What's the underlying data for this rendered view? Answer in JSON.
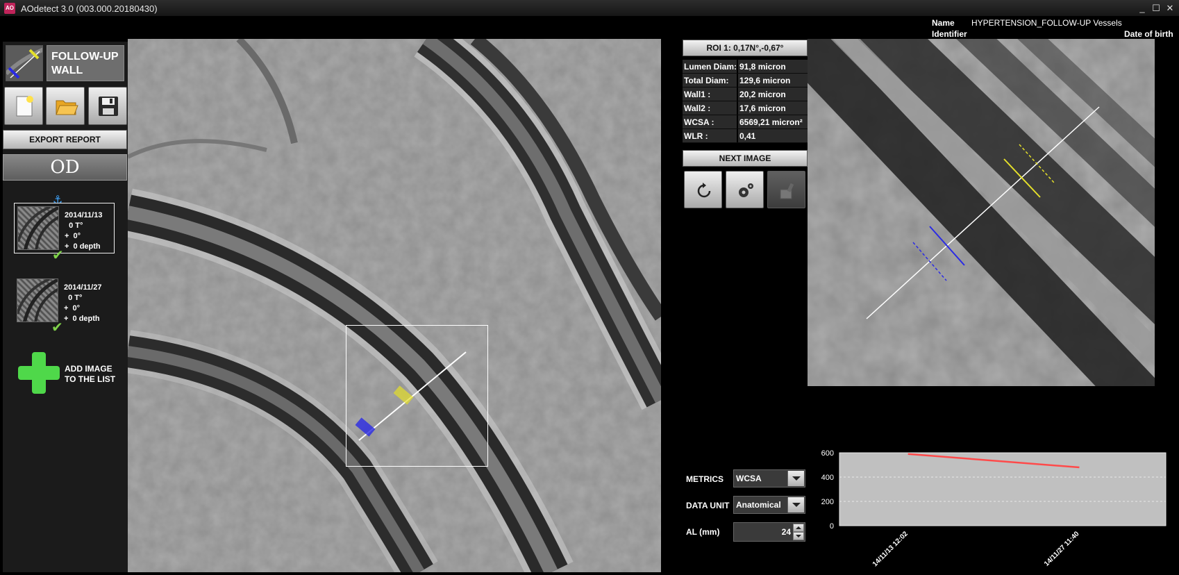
{
  "window": {
    "title": "AOdetect 3.0 (003.000.20180430)",
    "icon_text": "AO",
    "minimize": "_",
    "maximize": "☐",
    "close": "✕"
  },
  "patient": {
    "name_label": "Name",
    "name_value": "HYPERTENSION_FOLLOW-UP Vessels",
    "identifier_label": "Identifier",
    "dob_label": "Date of birth"
  },
  "left": {
    "mode_label_line1": "FOLLOW-UP",
    "mode_label_line2": "WALL",
    "export_label": "EXPORT REPORT",
    "eye_label": "OD",
    "images": [
      {
        "date": "2014/11/13",
        "t": "  0 T°",
        "d1": "+  0°",
        "d2": "+  0 depth",
        "selected": true
      },
      {
        "date": "2014/11/27",
        "t": "  0 T°",
        "d1": "+  0°",
        "d2": "+  0 depth",
        "selected": false
      }
    ],
    "add_label_line1": "ADD IMAGE",
    "add_label_line2": "TO THE LIST"
  },
  "roi": {
    "header": "ROI 1: 0,17N°,-0,67°",
    "metrics": [
      {
        "label": "Lumen Diam:",
        "value": "91,8  micron"
      },
      {
        "label": "Total Diam:",
        "value": "129,6  micron"
      },
      {
        "label": "Wall1 :",
        "value": "20,2  micron"
      },
      {
        "label": "Wall2 :",
        "value": "17,6  micron"
      },
      {
        "label": "WCSA :",
        "value": "6569,21  micron²"
      },
      {
        "label": "WLR :",
        "value": "0,41"
      }
    ],
    "next_label": "NEXT IMAGE"
  },
  "controls": {
    "metrics_label": "METRICS",
    "metrics_value": "WCSA",
    "unit_label": "DATA UNIT",
    "unit_value": "Anatomical",
    "al_label": "AL (mm)",
    "al_value": "24"
  },
  "colors": {
    "wall_marker_1": "#e5e02a",
    "wall_marker_2": "#2a2ae5",
    "series_line": "#ff4a4a",
    "plot_bg": "#c0c0c0",
    "add_plus": "#4fd84a"
  },
  "chart_data": {
    "type": "line",
    "categories": [
      "14/11/13 12:02",
      "14/11/27 11:40"
    ],
    "series": [
      {
        "values": [
          590,
          480
        ]
      }
    ],
    "ylim": [
      0,
      600
    ],
    "yticks": [
      0,
      200,
      400,
      600
    ],
    "grid": true,
    "title": "",
    "xlabel": "",
    "ylabel": ""
  }
}
